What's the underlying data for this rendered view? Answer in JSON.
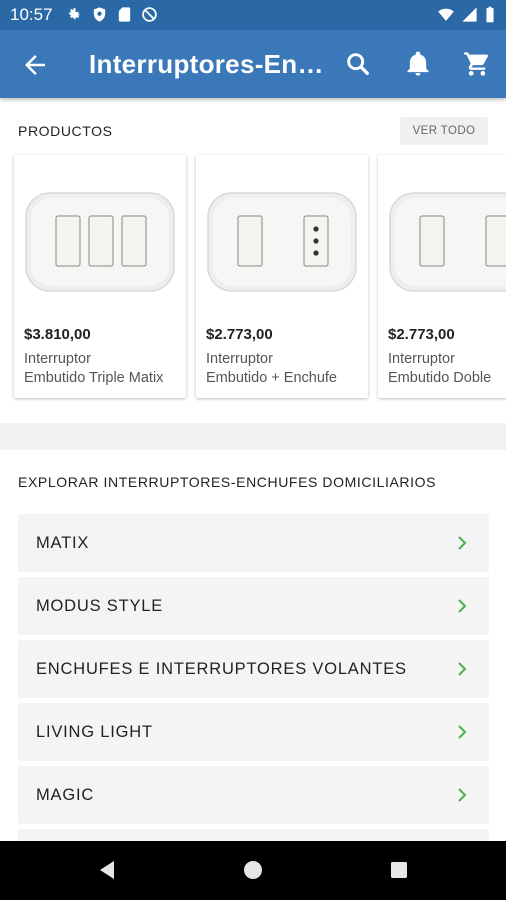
{
  "status_bar": {
    "time": "10:57"
  },
  "app_bar": {
    "title": "Interruptores-Enchufes Domiciliarios"
  },
  "products_section": {
    "header": "PRODUCTOS",
    "ver_todo": "VER TODO",
    "items": [
      {
        "price": "$3.810,00",
        "name_line1": "Interruptor",
        "name_line2": "Embutido Triple Matix"
      },
      {
        "price": "$2.773,00",
        "name_line1": "Interruptor",
        "name_line2": "Embutido + Enchufe"
      },
      {
        "price": "$2.773,00",
        "name_line1": "Interruptor",
        "name_line2": "Embutido Doble"
      }
    ]
  },
  "explore_section": {
    "header": "EXPLORAR INTERRUPTORES-ENCHUFES DOMICILIARIOS",
    "categories": [
      {
        "label": "MATIX"
      },
      {
        "label": "MODUS STYLE"
      },
      {
        "label": "ENCHUFES E INTERRUPTORES VOLANTES"
      },
      {
        "label": "LIVING LIGHT"
      },
      {
        "label": "MAGIC"
      }
    ]
  },
  "colors": {
    "primary": "#3a78b9",
    "status_bar": "#2a69a6",
    "chevron": "#4caf50"
  }
}
